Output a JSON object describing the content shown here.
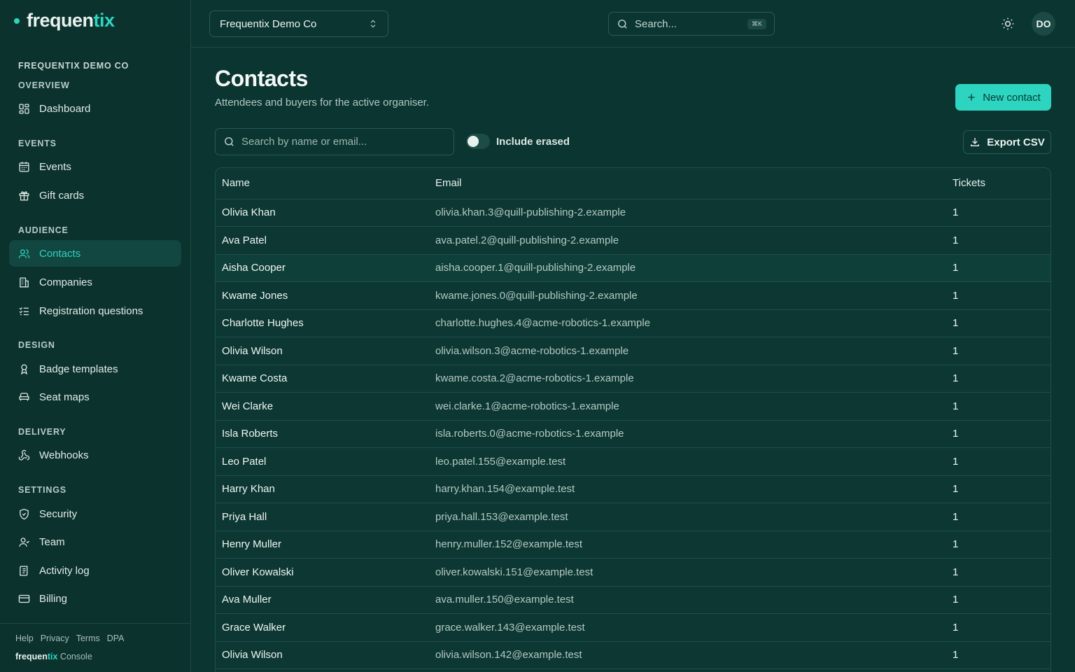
{
  "brand": {
    "name_main": "frequen",
    "name_accent": "tix"
  },
  "org_name": "FREQUENTIX DEMO CO",
  "nav": {
    "overview_label": "OVERVIEW",
    "dashboard": "Dashboard",
    "events_label": "EVENTS",
    "events": "Events",
    "gift_cards": "Gift cards",
    "audience_label": "AUDIENCE",
    "contacts": "Contacts",
    "companies": "Companies",
    "registration_questions": "Registration questions",
    "design_label": "DESIGN",
    "badge_templates": "Badge templates",
    "seat_maps": "Seat maps",
    "delivery_label": "DELIVERY",
    "webhooks": "Webhooks",
    "settings_label": "SETTINGS",
    "security": "Security",
    "team": "Team",
    "activity_log": "Activity log",
    "billing": "Billing"
  },
  "footer": {
    "help": "Help",
    "privacy": "Privacy",
    "terms": "Terms",
    "dpa": "DPA",
    "console": "Console"
  },
  "topbar": {
    "org_select": "Frequentix Demo Co",
    "search_placeholder": "Search...",
    "search_shortcut": "⌘K",
    "avatar_initials": "DO"
  },
  "page": {
    "title": "Contacts",
    "subtitle": "Attendees and buyers for the active organiser.",
    "new_contact": "New contact",
    "filter_placeholder": "Search by name or email...",
    "include_erased": "Include erased",
    "export_csv": "Export CSV"
  },
  "colors": {
    "accent": "#2dd4bf",
    "background": "#0b3530"
  },
  "table": {
    "headers": {
      "name": "Name",
      "email": "Email",
      "tickets": "Tickets"
    },
    "rows": [
      {
        "name": "Olivia Khan",
        "email": "olivia.khan.3@quill-publishing-2.example",
        "tickets": "1"
      },
      {
        "name": "Ava Patel",
        "email": "ava.patel.2@quill-publishing-2.example",
        "tickets": "1"
      },
      {
        "name": "Aisha Cooper",
        "email": "aisha.cooper.1@quill-publishing-2.example",
        "tickets": "1"
      },
      {
        "name": "Kwame Jones",
        "email": "kwame.jones.0@quill-publishing-2.example",
        "tickets": "1"
      },
      {
        "name": "Charlotte Hughes",
        "email": "charlotte.hughes.4@acme-robotics-1.example",
        "tickets": "1"
      },
      {
        "name": "Olivia Wilson",
        "email": "olivia.wilson.3@acme-robotics-1.example",
        "tickets": "1"
      },
      {
        "name": "Kwame Costa",
        "email": "kwame.costa.2@acme-robotics-1.example",
        "tickets": "1"
      },
      {
        "name": "Wei Clarke",
        "email": "wei.clarke.1@acme-robotics-1.example",
        "tickets": "1"
      },
      {
        "name": "Isla Roberts",
        "email": "isla.roberts.0@acme-robotics-1.example",
        "tickets": "1"
      },
      {
        "name": "Leo Patel",
        "email": "leo.patel.155@example.test",
        "tickets": "1"
      },
      {
        "name": "Harry Khan",
        "email": "harry.khan.154@example.test",
        "tickets": "1"
      },
      {
        "name": "Priya Hall",
        "email": "priya.hall.153@example.test",
        "tickets": "1"
      },
      {
        "name": "Henry Muller",
        "email": "henry.muller.152@example.test",
        "tickets": "1"
      },
      {
        "name": "Oliver Kowalski",
        "email": "oliver.kowalski.151@example.test",
        "tickets": "1"
      },
      {
        "name": "Ava Muller",
        "email": "ava.muller.150@example.test",
        "tickets": "1"
      },
      {
        "name": "Grace Walker",
        "email": "grace.walker.143@example.test",
        "tickets": "1"
      },
      {
        "name": "Olivia Wilson",
        "email": "olivia.wilson.142@example.test",
        "tickets": "1"
      }
    ]
  }
}
